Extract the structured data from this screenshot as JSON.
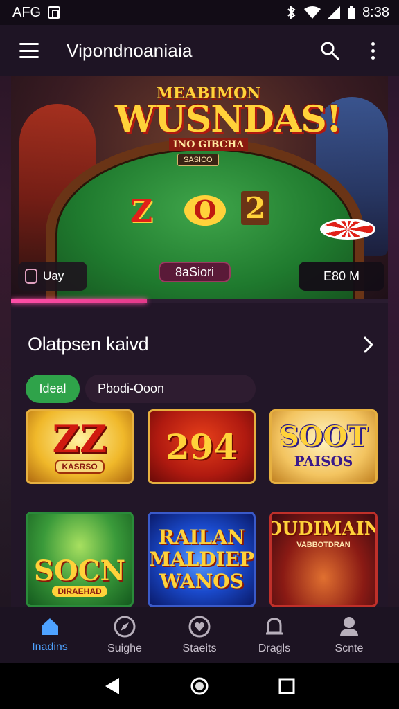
{
  "status_bar": {
    "left_text": "AFG",
    "time": "8:38"
  },
  "app_bar": {
    "title": "Vipondnoaniaia",
    "icons": [
      "menu-icon",
      "search-icon",
      "more-vert-icon"
    ]
  },
  "banner": {
    "headline_top": "MEABIMON",
    "headline_main": "WUSNDAS!",
    "headline_tagline": "INO GIBCHA",
    "small_chip": "SASICO",
    "reels": [
      "Z",
      "O",
      "2"
    ],
    "left_pill_label": "Uay",
    "center_pill_label": "8aSiori",
    "right_pill_label": "E80 M",
    "progress": 0.36
  },
  "section": {
    "title": "Olatpsen kaivd"
  },
  "filters": [
    {
      "label": "Ideal",
      "active": true
    },
    {
      "label": "Pbodi-Ooon",
      "active": false
    }
  ],
  "games": [
    {
      "title": "ZZ",
      "badge": "KASRSO"
    },
    {
      "title": "294",
      "badge": ""
    },
    {
      "title": "SOOT",
      "badge": "PAISOS"
    },
    {
      "title": "SOCN",
      "badge": "DIRAEHAD"
    },
    {
      "title": "RAILAN MALDIEP WANOS",
      "badge": ""
    },
    {
      "title": "SOUDIMAINS",
      "badge": "VABBOTDRAN"
    }
  ],
  "bottom_nav": [
    {
      "label": "Inadins",
      "icon": "home-icon",
      "active": true
    },
    {
      "label": "Suighe",
      "icon": "explore-icon",
      "active": false
    },
    {
      "label": "Staeits",
      "icon": "heart-icon",
      "active": false
    },
    {
      "label": "Dragls",
      "icon": "bell-icon",
      "active": false
    },
    {
      "label": "Scnte",
      "icon": "profile-icon",
      "active": false
    }
  ],
  "colors": {
    "accent_pink": "#ff4fa8",
    "active_chip": "#2fa34a",
    "active_nav": "#4ea2ff",
    "background": "#221628"
  }
}
